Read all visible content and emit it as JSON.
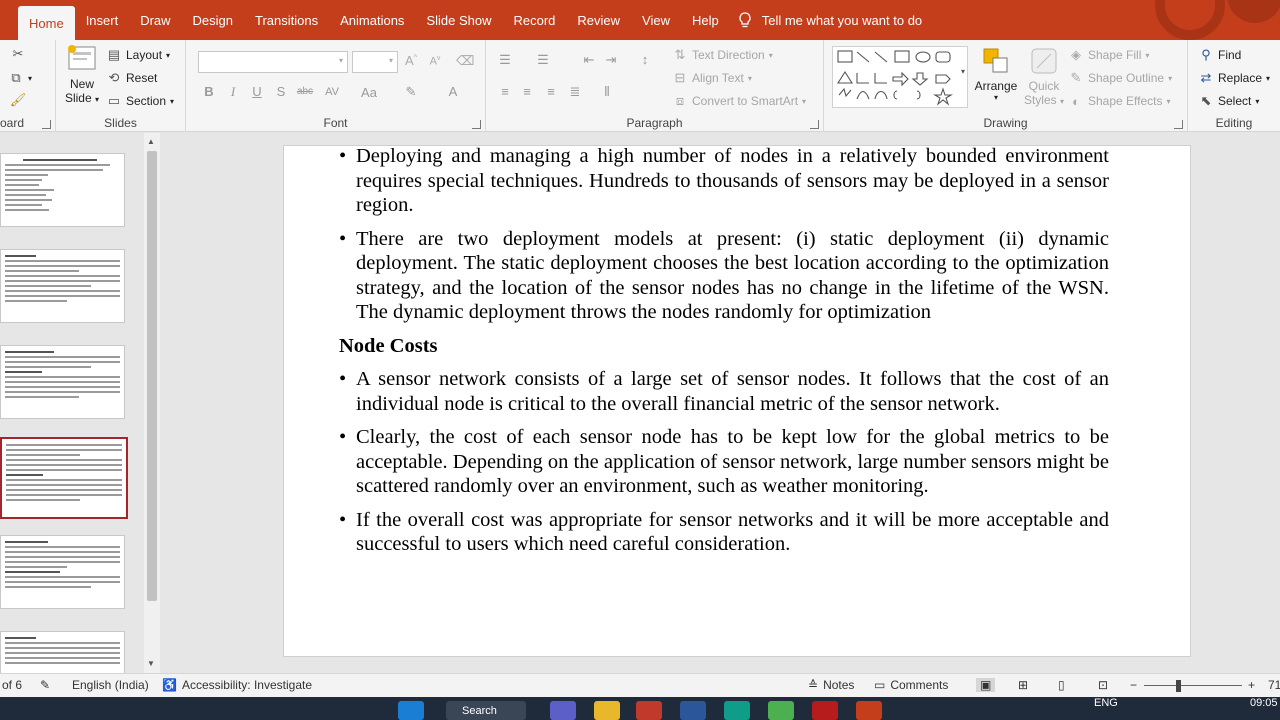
{
  "tabs": {
    "file_partial": "",
    "home": "Home",
    "insert": "Insert",
    "draw": "Draw",
    "design": "Design",
    "transitions": "Transitions",
    "animations": "Animations",
    "slideshow": "Slide Show",
    "record": "Record",
    "review": "Review",
    "view": "View",
    "help": "Help",
    "tellme": "Tell me what you want to do"
  },
  "ribbon": {
    "clipboard_label": "oard",
    "slides": {
      "new_slide_line1": "New",
      "new_slide_line2": "Slide",
      "layout": "Layout",
      "reset": "Reset",
      "section": "Section",
      "label": "Slides"
    },
    "font": {
      "label": "Font",
      "bold": "B",
      "italic": "I",
      "underline": "U",
      "strike": "S",
      "abc": "abc",
      "spacing": "AV",
      "case": "Aa"
    },
    "paragraph": {
      "label": "Paragraph",
      "text_direction": "Text Direction",
      "align_text": "Align Text",
      "convert_smartart": "Convert to SmartArt"
    },
    "drawing": {
      "label": "Drawing",
      "arrange": "Arrange",
      "quick_styles_line1": "Quick",
      "quick_styles_line2": "Styles",
      "shape_fill": "Shape Fill",
      "shape_outline": "Shape Outline",
      "shape_effects": "Shape Effects"
    },
    "editing": {
      "label": "Editing",
      "find": "Find",
      "replace": "Replace",
      "select": "Select"
    }
  },
  "slide": {
    "bullets_top": [
      "Deploying and managing a high number of nodes in a relatively bounded environment requires special techniques. Hundreds to thousands of sensors may be deployed in a sensor region.",
      " There are two deployment models at present: (i) static deployment (ii) dynamic deployment. The static deployment chooses the best location according to the optimization strategy, and the location of the sensor nodes has no change in the lifetime of the WSN. The dynamic deployment throws the nodes randomly for optimization"
    ],
    "heading": "Node Costs",
    "bullets_bottom": [
      "A sensor network consists of a large set of sensor nodes. It follows that the cost of an individual node is critical to the overall financial metric of the sensor network.",
      "Clearly, the cost of each sensor node has to be kept low for the global metrics to be acceptable. Depending on the application of sensor network, large number sensors might be scattered randomly over an environment, such as weather monitoring.",
      "If the overall cost was appropriate for sensor networks and it will be more acceptable and successful to users which need careful consideration."
    ]
  },
  "status": {
    "slide_count": "of 6",
    "language": "English (India)",
    "accessibility": "Accessibility: Investigate",
    "notes": "Notes",
    "comments": "Comments",
    "zoom_minus": "−",
    "zoom_plus": "+",
    "zoom": "71"
  },
  "taskbar": {
    "search": "Search",
    "lang": "ENG",
    "time": "09:05"
  },
  "colors": {
    "accent": "#c43e1c",
    "selected_thumb": "#a4262c"
  }
}
